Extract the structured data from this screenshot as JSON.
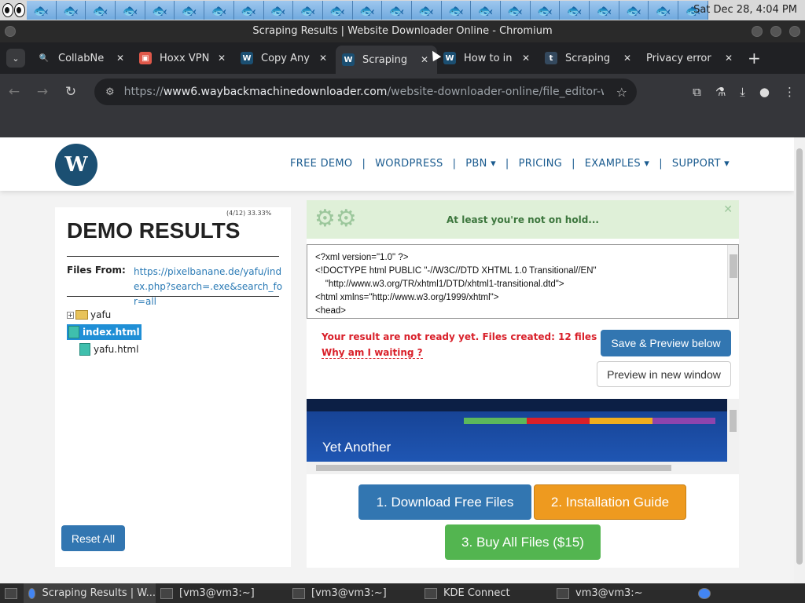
{
  "system": {
    "clock": "Sat Dec 28,  4:04 PM"
  },
  "window": {
    "title": "Scraping Results | Website Downloader Online - Chromium"
  },
  "tabs": [
    {
      "label": "CollabNe",
      "icon": "search-icon",
      "color": "#4285f4"
    },
    {
      "label": "Hoxx VPN",
      "icon": "image-icon",
      "color": "#e0584a"
    },
    {
      "label": "Copy Any",
      "icon": "w-icon",
      "color": "#1b4f72"
    },
    {
      "label": "Scraping",
      "icon": "w-icon",
      "color": "#1b4f72"
    },
    {
      "label": "How to in",
      "icon": "w-icon",
      "color": "#1b4f72"
    },
    {
      "label": "Scraping",
      "icon": "t-icon",
      "color": "#34495e"
    },
    {
      "label": "Privacy error",
      "icon": "",
      "color": ""
    }
  ],
  "address": {
    "prefix": "https://",
    "host": "www6.waybackmachinedownloader.com",
    "path": "/website-downloader-online/file_editor-website..."
  },
  "site": {
    "logo": "W",
    "menu": [
      "FREE DEMO",
      "WORDPRESS",
      "PBN ▾",
      "PRICING",
      "EXAMPLES ▾",
      "SUPPORT ▾"
    ],
    "progress": "(4/12) 33.33%",
    "demo_title": "DEMO RESULTS",
    "files_from_label": "Files From:",
    "files_from_url": "https://pixelbanane.de/yafu/index.php?search=.exe&search_for=all",
    "tree": {
      "folder": "yafu",
      "selected_file": "index.html",
      "file2": "yafu.html"
    },
    "reset_label": "Reset All",
    "alert": "At least you're not on hold...",
    "code_lines": [
      "<?xml version=\"1.0\" ?>",
      "<!DOCTYPE html PUBLIC \"-//W3C//DTD XHTML 1.0 Transitional//EN\"",
      "    \"http://www.w3.org/TR/xhtml1/DTD/xhtml1-transitional.dtd\">",
      "<html xmlns=\"http://www.w3.org/1999/xhtml\">",
      "<head>"
    ],
    "waiting_text": "Your result are not ready yet. Files created: 12 files (26%)",
    "why_text": "Why am I waiting ?",
    "save_label": "Save & Preview below",
    "preview_window_label": "Preview in new window",
    "preview_text": "Yet Another",
    "download_label": "1. Download Free Files",
    "install_label": "2. Installation Guide",
    "buy_label": "3. Buy All Files ($15)"
  },
  "taskbar": [
    {
      "label": "Scraping Results | W..."
    },
    {
      "label": "[vm3@vm3:~]"
    },
    {
      "label": "[vm3@vm3:~]"
    },
    {
      "label": "KDE Connect"
    },
    {
      "label": "vm3@vm3:~"
    }
  ]
}
